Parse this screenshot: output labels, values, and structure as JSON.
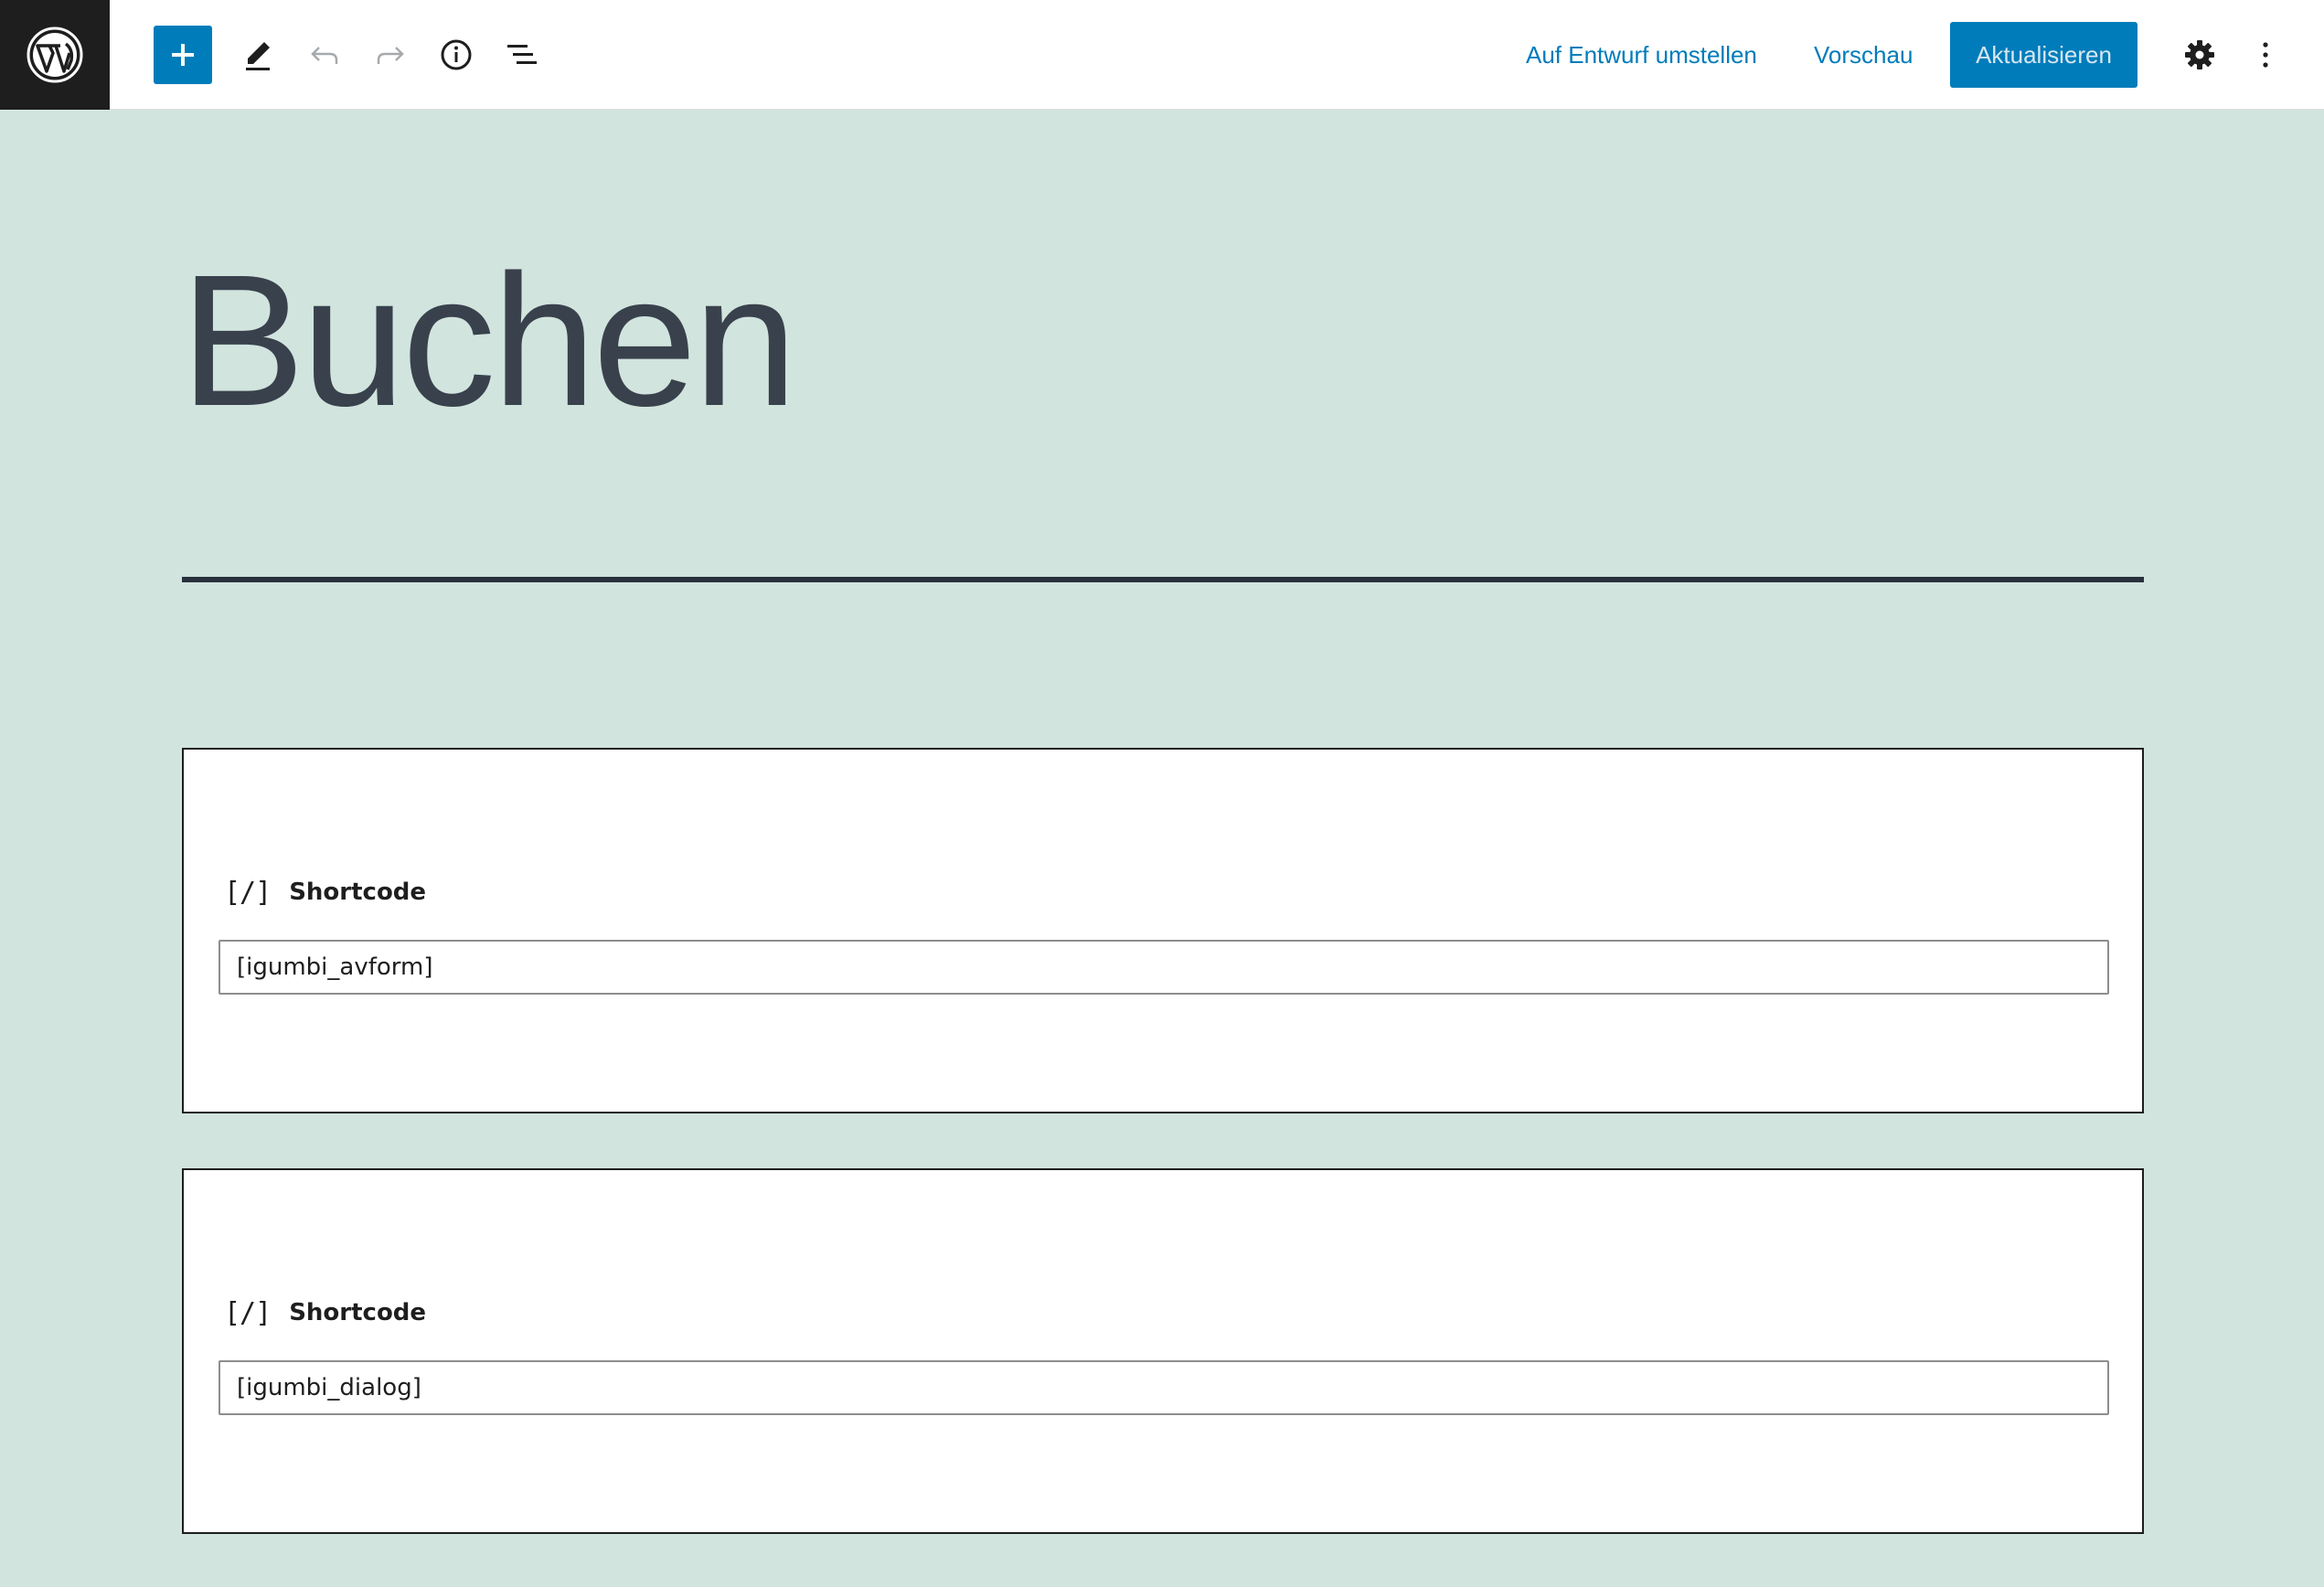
{
  "toolbar": {
    "logo_icon": "wordpress-logo-icon",
    "inserter_icon": "plus-icon",
    "tool_icon": "pencil-icon",
    "undo_icon": "undo-icon",
    "redo_icon": "redo-icon",
    "info_icon": "info-icon",
    "outline_icon": "list-view-icon",
    "switch_to_draft_label": "Auf Entwurf umstellen",
    "preview_label": "Vorschau",
    "update_label": "Aktualisieren",
    "settings_icon": "gear-icon",
    "more_icon": "more-vertical-icon"
  },
  "colors": {
    "accent": "#007cba",
    "canvas_background": "#d1e4dd",
    "logo_background": "#1e1e1e",
    "title_color": "#39414d"
  },
  "page": {
    "title": "Buchen"
  },
  "blocks": [
    {
      "icon": "[/]",
      "label": "Shortcode",
      "value": "[igumbi_avform]"
    },
    {
      "icon": "[/]",
      "label": "Shortcode",
      "value": "[igumbi_dialog]"
    }
  ]
}
